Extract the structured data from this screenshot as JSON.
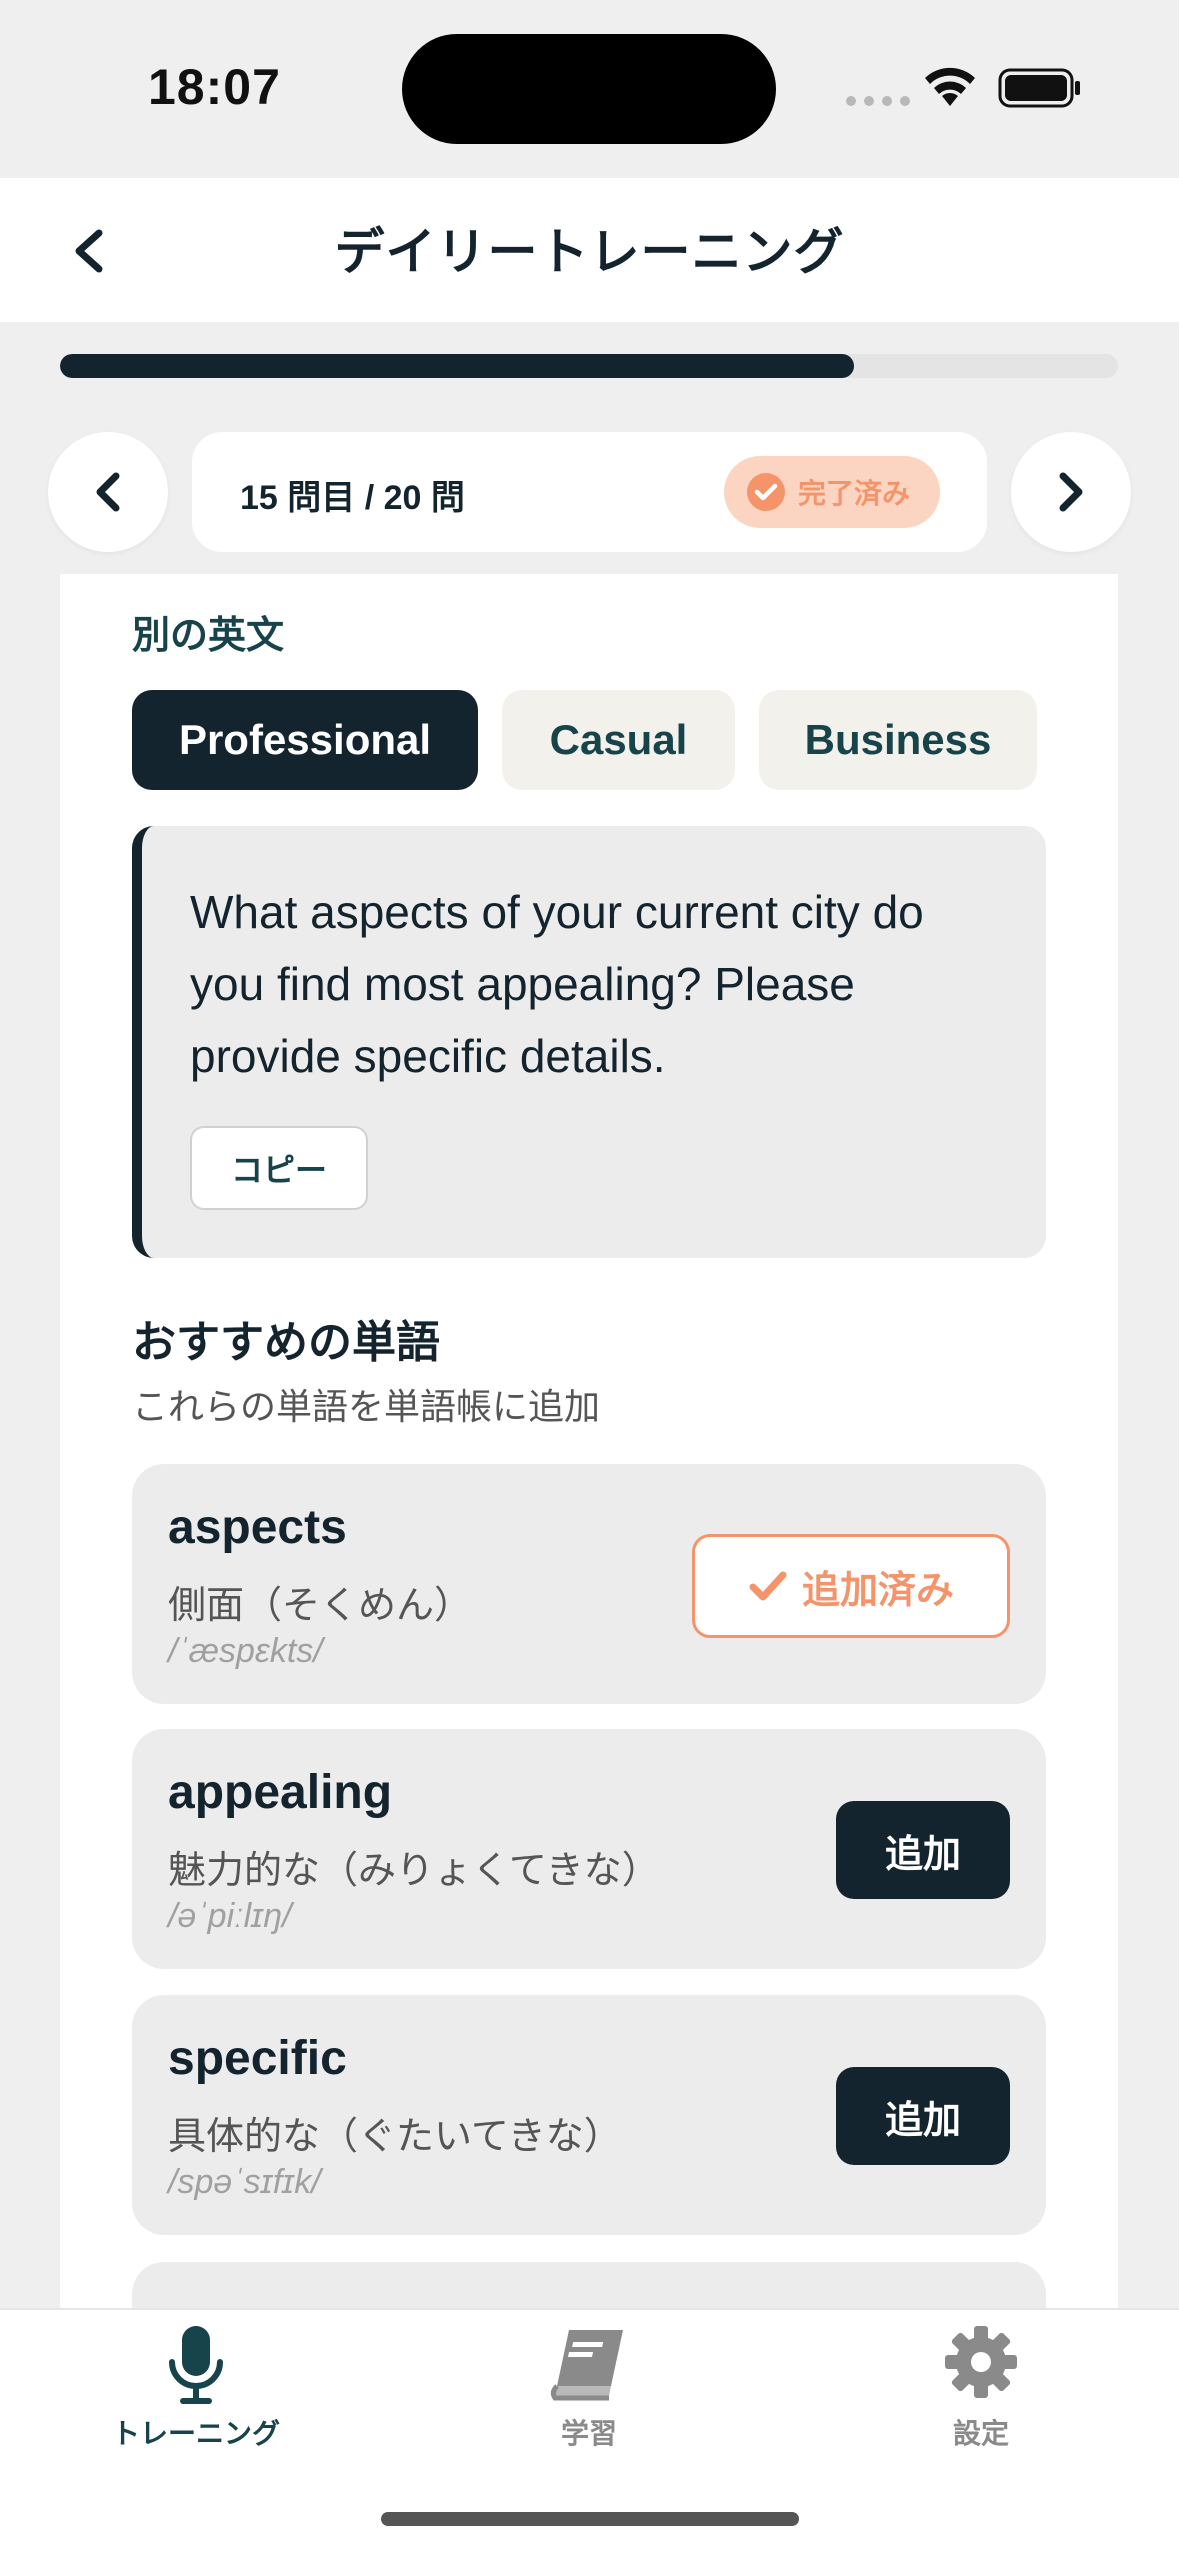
{
  "status_bar": {
    "time": "18:07"
  },
  "header": {
    "title": "デイリートレーニング",
    "back_icon": "chevron-left-icon"
  },
  "progress": {
    "fraction": 0.75
  },
  "question_nav": {
    "counter": "15 問目 / 20 問",
    "badge_label": "完了済み",
    "prev_icon": "chevron-left-icon",
    "next_icon": "chevron-right-icon"
  },
  "alternatives": {
    "section_label": "別の英文",
    "tones": [
      {
        "label": "Professional",
        "active": true
      },
      {
        "label": "Casual",
        "active": false
      },
      {
        "label": "Business",
        "active": false
      }
    ],
    "sentence": "What aspects of your current city do you find most appealing? Please provide specific details.",
    "copy_label": "コピー"
  },
  "recommended": {
    "title": "おすすめの単語",
    "subtitle": "これらの単語を単語帳に追加",
    "words": [
      {
        "word": "aspects",
        "meaning": "側面（そくめん）",
        "ipa": "/ˈæspɛkts/",
        "button": "追加済み",
        "added": true
      },
      {
        "word": "appealing",
        "meaning": "魅力的な（みりょくてきな）",
        "ipa": "/əˈpiːlɪŋ/",
        "button": "追加",
        "added": false
      },
      {
        "word": "specific",
        "meaning": "具体的な（ぐたいてきな）",
        "ipa": "/spəˈsɪfɪk/",
        "button": "追加",
        "added": false
      }
    ]
  },
  "tabbar": {
    "tabs": [
      {
        "label": "トレーニング",
        "icon": "microphone-icon",
        "active": true
      },
      {
        "label": "学習",
        "icon": "book-icon",
        "active": false
      },
      {
        "label": "設定",
        "icon": "gear-icon",
        "active": false
      }
    ]
  },
  "colors": {
    "primary": "#14242f",
    "accent": "#f5946a",
    "badge_bg": "#fcd5c2",
    "teal_text": "#17434a"
  }
}
